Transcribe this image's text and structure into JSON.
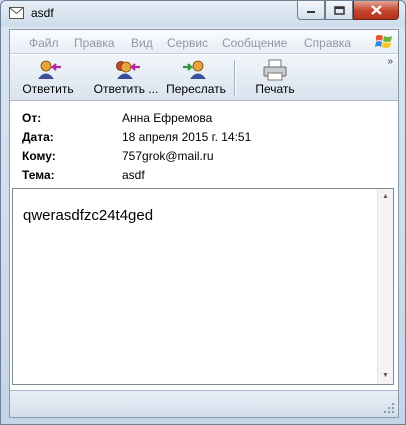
{
  "window": {
    "title": "asdf",
    "icon": "envelope-icon",
    "buttons": [
      "minimize-icon",
      "maximize-icon",
      "close-icon"
    ]
  },
  "menu": {
    "items": [
      "Файл",
      "Правка",
      "Вид",
      "Сервис",
      "Сообщение",
      "Справка"
    ]
  },
  "toolbar": {
    "reply": {
      "label": "Ответить",
      "icon": "reply-icon"
    },
    "reply_all": {
      "label": "Ответить ...",
      "icon": "reply-all-icon"
    },
    "forward": {
      "label": "Переслать",
      "icon": "forward-icon"
    },
    "print": {
      "label": "Печать",
      "icon": "printer-icon"
    },
    "overflow": "»"
  },
  "headers": [
    {
      "key": "От:",
      "value": "Анна Ефремова"
    },
    {
      "key": "Дата:",
      "value": "18 апреля 2015 г. 14:51"
    },
    {
      "key": "Кому:",
      "value": "757grok@mail.ru"
    },
    {
      "key": "Тема:",
      "value": "asdf"
    }
  ],
  "message": {
    "body": "qwerasdfzc24t4ged"
  },
  "colors": {
    "menu_disabled": "#8e98a4",
    "close_button": "#c5432c",
    "title_bar": "#cddbea"
  }
}
